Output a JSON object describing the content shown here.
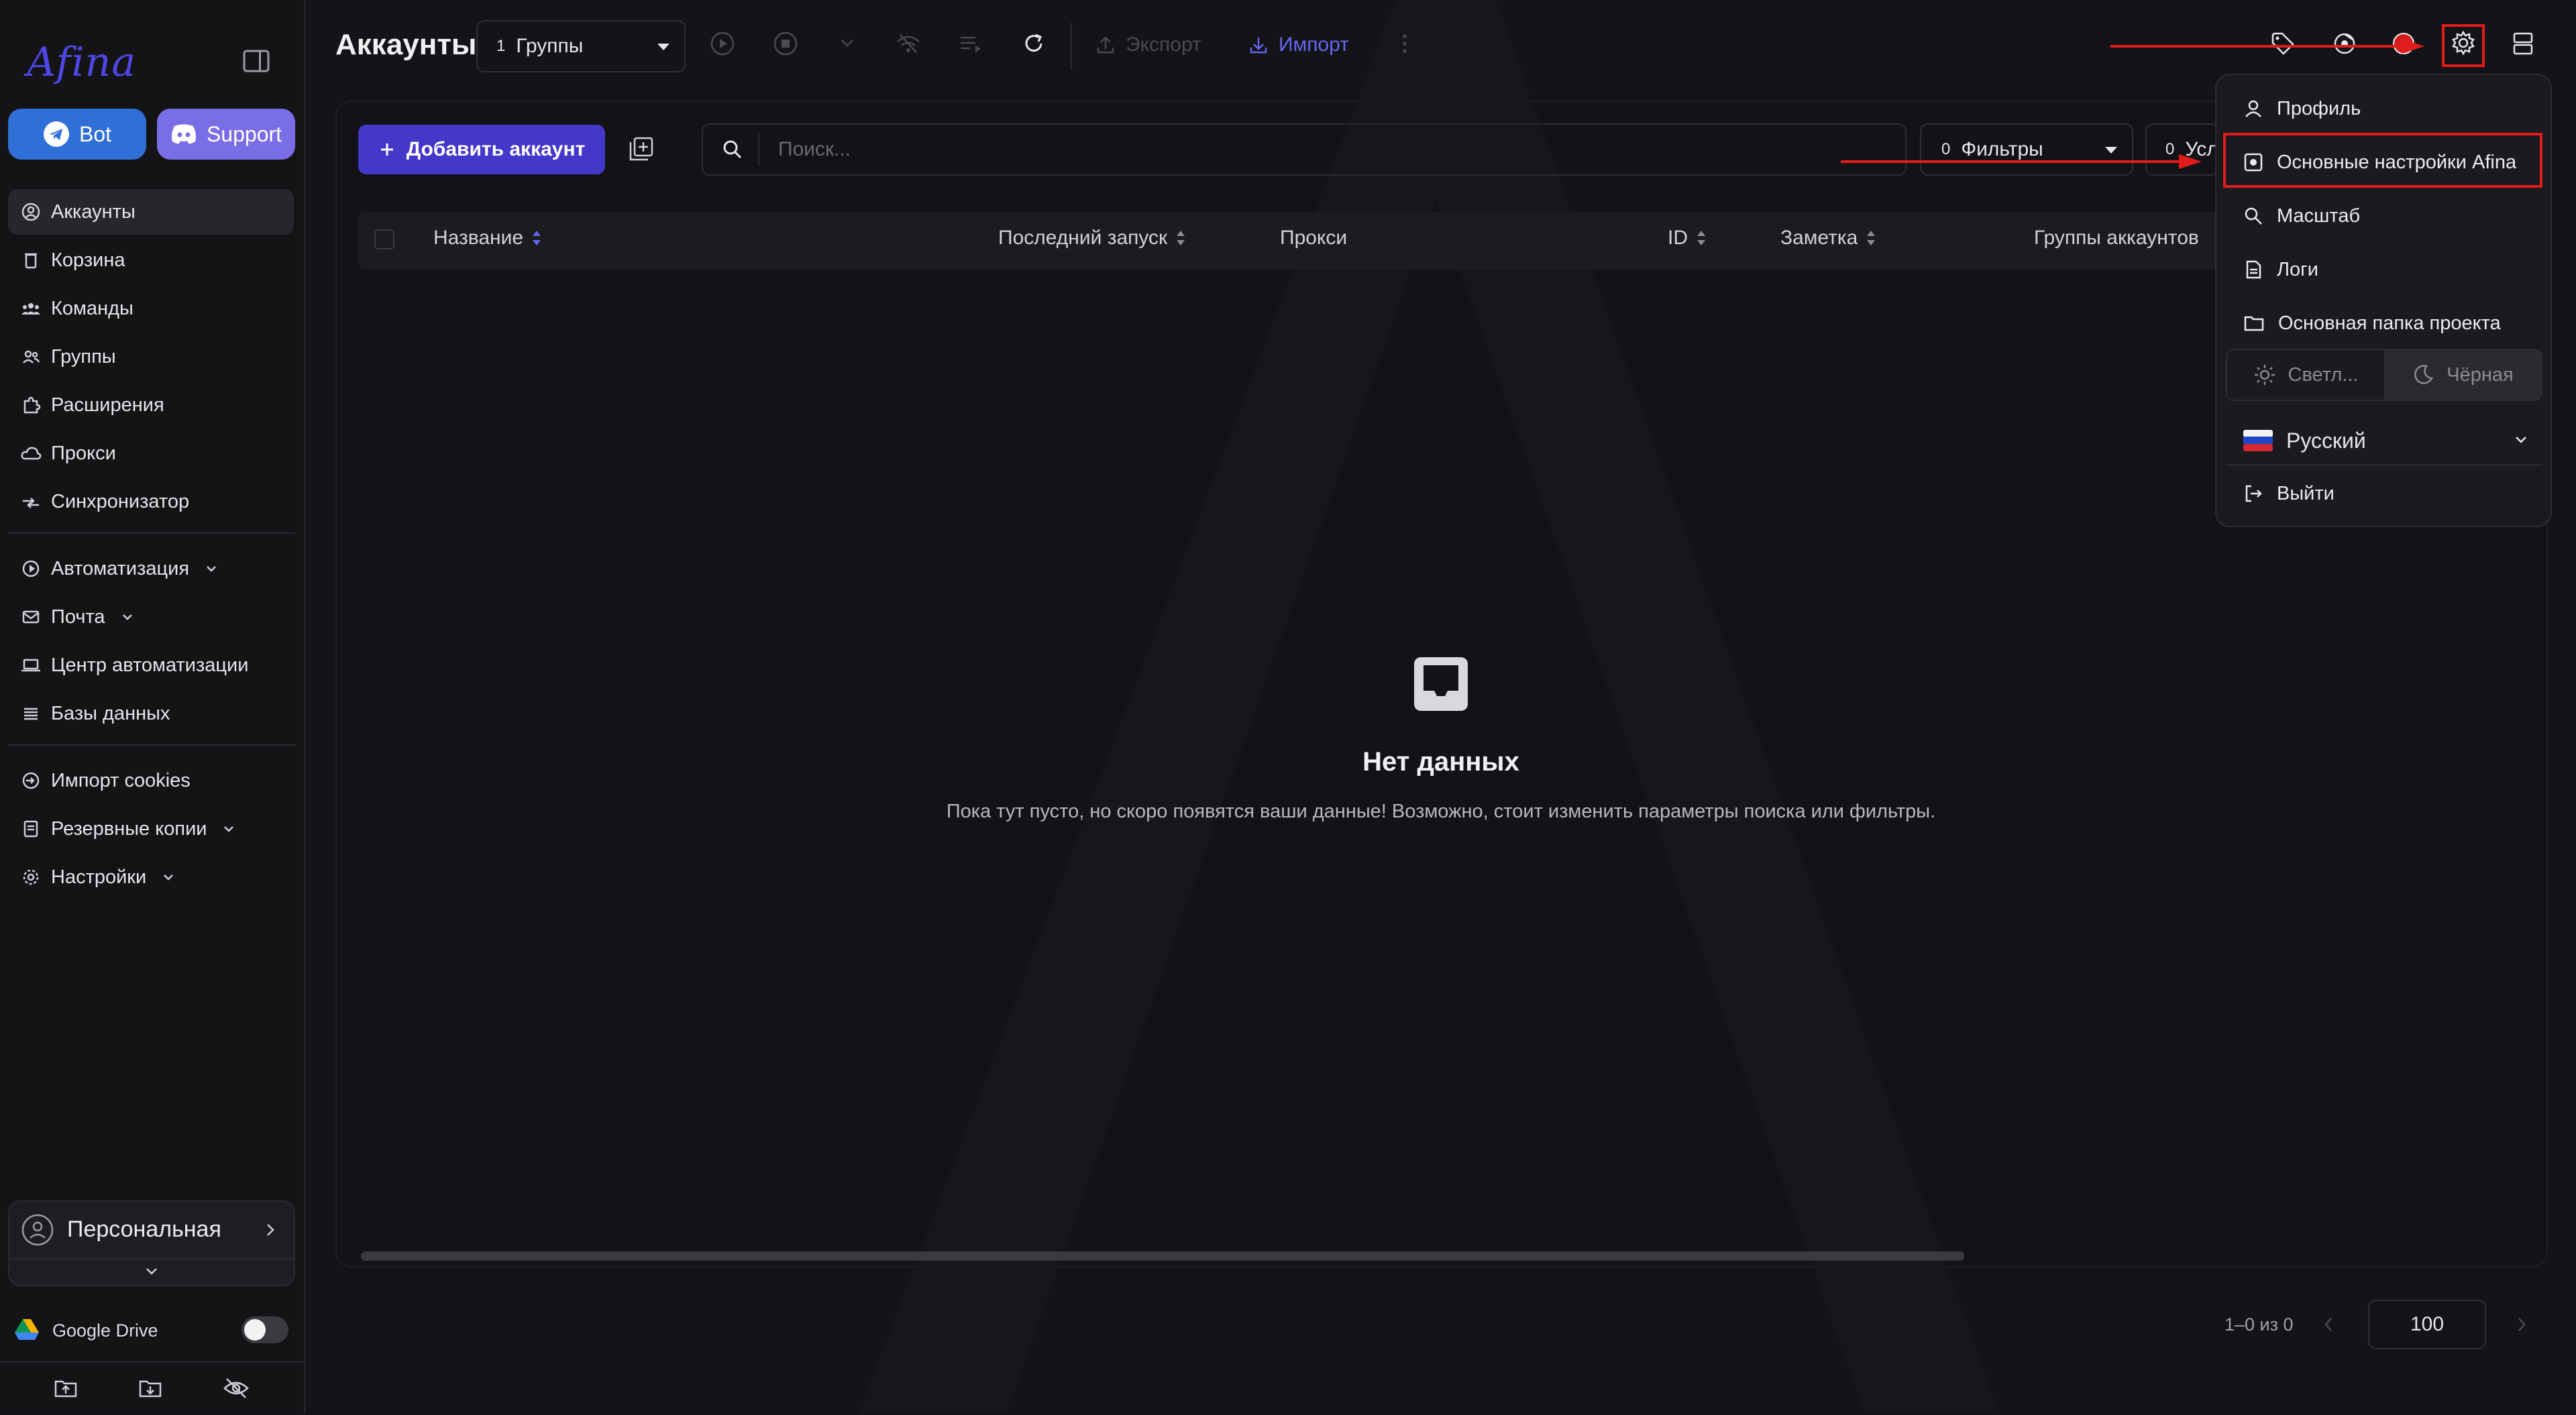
{
  "app": {
    "logo": "Afina"
  },
  "sidebar": {
    "bot_label": "Bot",
    "support_label": "Support",
    "items": [
      {
        "label": "Аккаунты",
        "icon": "user-circle-icon"
      },
      {
        "label": "Корзина",
        "icon": "trash-icon"
      },
      {
        "label": "Команды",
        "icon": "team-icon"
      },
      {
        "label": "Группы",
        "icon": "group-icon"
      },
      {
        "label": "Расширения",
        "icon": "puzzle-icon"
      },
      {
        "label": "Прокси",
        "icon": "cloud-icon"
      },
      {
        "label": "Синхронизатор",
        "icon": "sync-icon"
      },
      {
        "label": "Автоматизация",
        "icon": "automation-icon"
      },
      {
        "label": "Почта",
        "icon": "mail-icon"
      },
      {
        "label": "Центр автоматизации",
        "icon": "laptop-icon"
      },
      {
        "label": "Базы данных",
        "icon": "list-icon"
      },
      {
        "label": "Импорт cookies",
        "icon": "import-icon"
      },
      {
        "label": "Резервные копии",
        "icon": "backup-icon"
      },
      {
        "label": "Настройки",
        "icon": "gear-icon"
      }
    ],
    "workspace": "Персональная",
    "google_drive": "Google Drive"
  },
  "header": {
    "title": "Аккаунты",
    "group_count": "1",
    "group_label": "Группы",
    "export_label": "Экспорт",
    "import_label": "Импорт"
  },
  "toolbar": {
    "add_account": "Добавить аккаунт",
    "search_placeholder": "Поиск...",
    "filters_count": "0",
    "filters_label": "Фильтры",
    "conditions_count": "0",
    "conditions_label": "Усл"
  },
  "table": {
    "columns": [
      "Название",
      "Последний запуск",
      "Прокси",
      "ID",
      "Заметка",
      "Группы аккаунтов"
    ]
  },
  "empty": {
    "title": "Нет данных",
    "subtitle": "Пока тут пусто, но скоро появятся ваши данные! Возможно, стоит изменить параметры поиска или фильтры."
  },
  "pager": {
    "range": "1–0 из 0",
    "page_size": "100"
  },
  "menu": {
    "profile": "Профиль",
    "main_settings": "Основные настройки Afina",
    "scale": "Масштаб",
    "logs": "Логи",
    "project_folder": "Основная папка проекта",
    "theme_light": "Светл...",
    "theme_dark": "Чёрная",
    "language": "Русский",
    "logout": "Выйти"
  },
  "colors": {
    "accent": "#4338ca",
    "bot_button": "#2f6fd6",
    "support_button": "#7a6ee6",
    "annotation": "#e21b1b"
  }
}
